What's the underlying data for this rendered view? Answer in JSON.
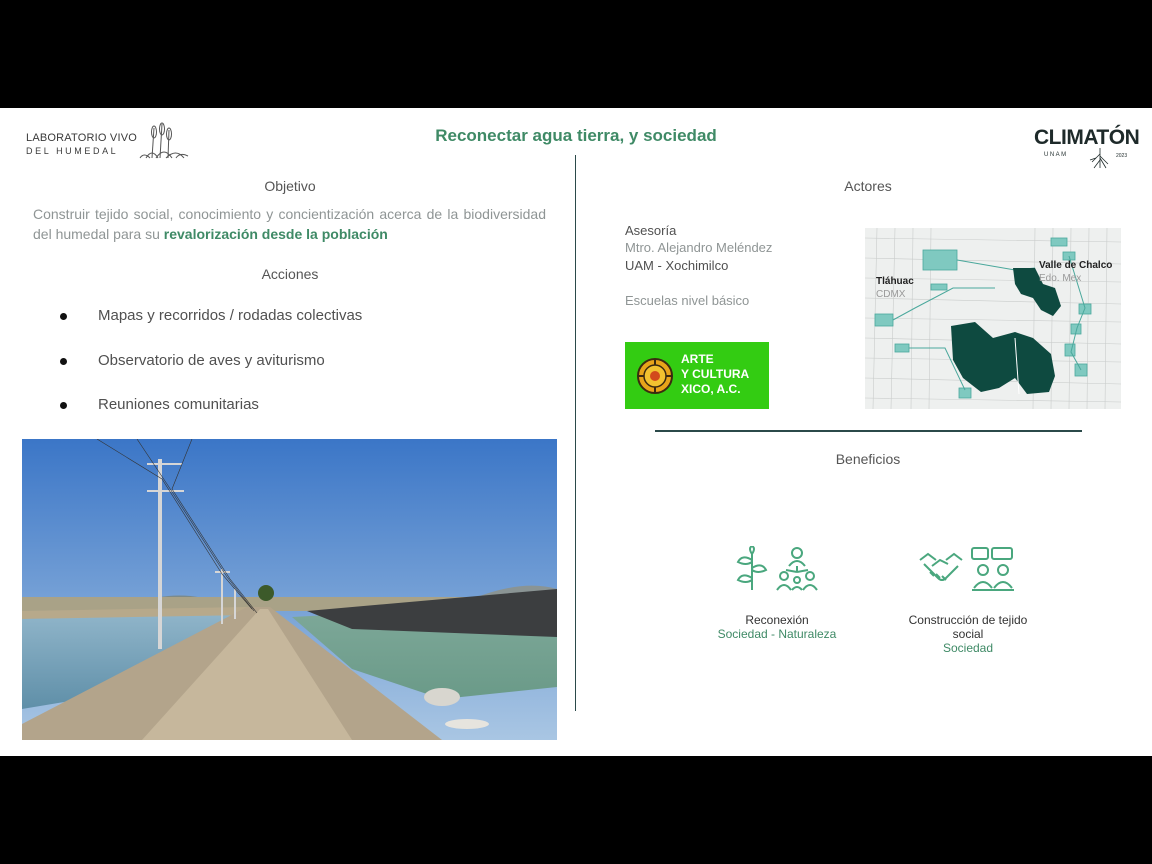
{
  "header": {
    "logo_left_line1": "LABORATORIO VIVO",
    "logo_left_line2": "DEL HUMEDAL",
    "title": "Reconectar agua tierra, y sociedad",
    "logo_right_name": "CLIMATÓN",
    "logo_right_sub": "UNAM",
    "logo_right_year": "2023"
  },
  "objetivo": {
    "heading": "Objetivo",
    "text": "Construir tejido social, conocimiento y concientización acerca de la biodiversidad del humedal para su ",
    "highlight": "revalorización desde la población"
  },
  "acciones": {
    "heading": "Acciones",
    "items": [
      "Mapas y recorridos / rodadas colectivas",
      "Observatorio de aves y aviturismo",
      "Reuniones comunitarias"
    ]
  },
  "actores": {
    "heading": "Actores",
    "asesoria_label": "Asesoría",
    "asesor_name": "Mtro. Alejandro Meléndez",
    "institution": "UAM - Xochimilco",
    "schools": "Escuelas nivel básico",
    "partner_logo_lines": [
      "ARTE",
      "Y CULTURA",
      "XICO, A.C."
    ]
  },
  "map": {
    "label_tlahuac": "Tláhuac",
    "label_cdmx": "CDMX",
    "label_valle": "Valle de Chalco",
    "label_edomex": "Edo. Mex",
    "color_dark": "#0e4a40",
    "color_light": "#7fc9c0"
  },
  "beneficios": {
    "heading": "Beneficios",
    "items": [
      {
        "title": "Reconexión",
        "subtitle": "Sociedad - Naturaleza",
        "icons": [
          "plants-icon",
          "community-network-icon"
        ]
      },
      {
        "title": "Construcción de tejido social",
        "subtitle": "Sociedad",
        "icons": [
          "handshake-icon",
          "people-discussion-icon"
        ]
      }
    ]
  },
  "colors": {
    "accent_green": "#3f8a66",
    "icon_green": "#4aa77e",
    "partner_green": "#33cc12",
    "divider": "#2b4a4a"
  }
}
